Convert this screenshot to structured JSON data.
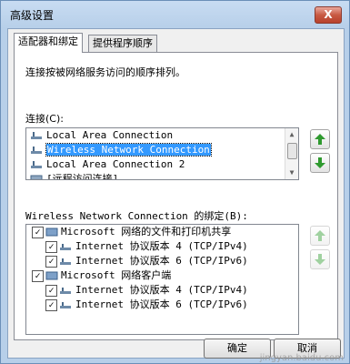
{
  "window": {
    "title": "高级设置",
    "close_label": "X"
  },
  "tabs": [
    {
      "label": "适配器和绑定",
      "active": true
    },
    {
      "label": "提供程序顺序",
      "active": false
    }
  ],
  "adapters": {
    "description": "连接按被网络服务访问的顺序排列。",
    "connections_label": "连接(C):",
    "connections": [
      "Local Area Connection",
      "Wireless Network Connection",
      "Local Area Connection 2",
      "[远程访问连接]"
    ],
    "selected_index": 1,
    "bindings_label": "Wireless Network Connection 的绑定(B):",
    "bindings": [
      {
        "label": "Microsoft 网络的文件和打印机共享",
        "level": 0,
        "checked": true
      },
      {
        "label": "Internet 协议版本 4 (TCP/IPv4)",
        "level": 1,
        "checked": true
      },
      {
        "label": "Internet 协议版本 6 (TCP/IPv6)",
        "level": 1,
        "checked": true
      },
      {
        "label": "Microsoft 网络客户端",
        "level": 0,
        "checked": true
      },
      {
        "label": "Internet 协议版本 4 (TCP/IPv4)",
        "level": 1,
        "checked": true
      },
      {
        "label": "Internet 协议版本 6 (TCP/IPv6)",
        "level": 1,
        "checked": true
      }
    ]
  },
  "footer": {
    "ok_label": "确定",
    "cancel_label": "取消"
  },
  "watermark": "jingyan.baidu.com",
  "colors": {
    "selection": "#3399ff",
    "arrow_green": "#2f9a2f"
  }
}
